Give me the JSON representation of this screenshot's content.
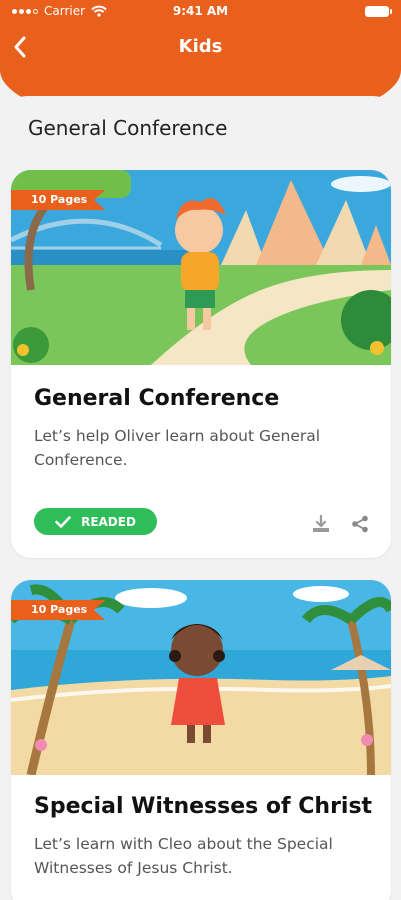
{
  "status": {
    "carrier": "Carrier",
    "time": "9:41 AM"
  },
  "nav": {
    "title": "Kids"
  },
  "section": {
    "title": "General Conference"
  },
  "cards": [
    {
      "pages": "10 Pages",
      "title": "General Conference",
      "description": "Let’s help Oliver learn about General Conference.",
      "status_label": "READED"
    },
    {
      "pages": "10 Pages",
      "title": "Special Witnesses of Christ",
      "description": "Let’s learn with Cleo about the Special Witnesses of Jesus Christ."
    }
  ],
  "colors": {
    "brand": "#e8601c",
    "success": "#2fbd5a",
    "background": "#f2f2f2"
  },
  "icons": [
    "back-chevron-icon",
    "wifi-icon",
    "battery-icon",
    "check-icon",
    "download-icon",
    "share-icon"
  ]
}
